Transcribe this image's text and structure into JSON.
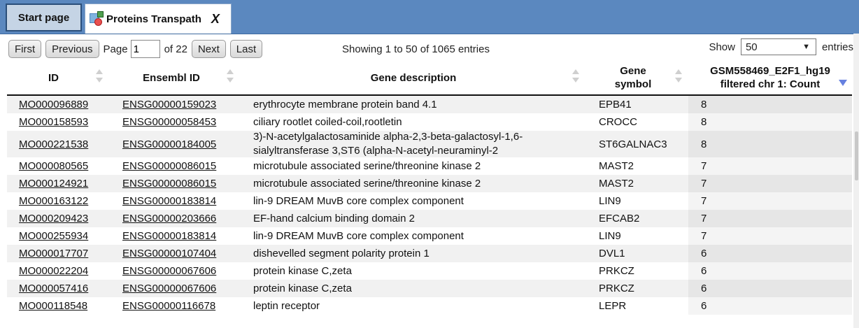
{
  "tabs": [
    {
      "label": "Start page",
      "active": false
    },
    {
      "label": "Proteins Transpath",
      "active": true,
      "close": "X"
    }
  ],
  "pager": {
    "first": "First",
    "previous": "Previous",
    "page_label": "Page",
    "page_value": "1",
    "of_label": "of 22",
    "next": "Next",
    "last": "Last"
  },
  "info": "Showing 1 to 50 of 1065 entries",
  "length": {
    "show": "Show",
    "value": "50",
    "entries": "entries"
  },
  "columns": [
    {
      "key": "id",
      "label": "ID"
    },
    {
      "key": "ensembl",
      "label": "Ensembl ID"
    },
    {
      "key": "desc",
      "label": "Gene description"
    },
    {
      "key": "symbol",
      "label": "Gene symbol"
    },
    {
      "key": "count",
      "label": "GSM558469_E2F1_hg19 filtered chr 1: Count"
    }
  ],
  "rows": [
    {
      "id": "MO000096889",
      "ensembl": "ENSG00000159023",
      "desc": "erythrocyte membrane protein band 4.1",
      "symbol": "EPB41",
      "count": "8"
    },
    {
      "id": "MO000158593",
      "ensembl": "ENSG00000058453",
      "desc": "ciliary rootlet coiled-coil,rootletin",
      "symbol": "CROCC",
      "count": "8"
    },
    {
      "id": "MO000221538",
      "ensembl": "ENSG00000184005",
      "desc": "3)-N-acetylgalactosaminide alpha-2,3-beta-galactosyl-1,6-sialyltransferase 3,ST6 (alpha-N-acetyl-neuraminyl-2",
      "symbol": "ST6GALNAC3",
      "count": "8"
    },
    {
      "id": "MO000080565",
      "ensembl": "ENSG00000086015",
      "desc": "microtubule associated serine/threonine kinase 2",
      "symbol": "MAST2",
      "count": "7"
    },
    {
      "id": "MO000124921",
      "ensembl": "ENSG00000086015",
      "desc": "microtubule associated serine/threonine kinase 2",
      "symbol": "MAST2",
      "count": "7"
    },
    {
      "id": "MO000163122",
      "ensembl": "ENSG00000183814",
      "desc": "lin-9 DREAM MuvB core complex component",
      "symbol": "LIN9",
      "count": "7"
    },
    {
      "id": "MO000209423",
      "ensembl": "ENSG00000203666",
      "desc": "EF-hand calcium binding domain 2",
      "symbol": "EFCAB2",
      "count": "7"
    },
    {
      "id": "MO000255934",
      "ensembl": "ENSG00000183814",
      "desc": "lin-9 DREAM MuvB core complex component",
      "symbol": "LIN9",
      "count": "7"
    },
    {
      "id": "MO000017707",
      "ensembl": "ENSG00000107404",
      "desc": "dishevelled segment polarity protein 1",
      "symbol": "DVL1",
      "count": "6"
    },
    {
      "id": "MO000022204",
      "ensembl": "ENSG00000067606",
      "desc": "protein kinase C,zeta",
      "symbol": "PRKCZ",
      "count": "6"
    },
    {
      "id": "MO000057416",
      "ensembl": "ENSG00000067606",
      "desc": "protein kinase C,zeta",
      "symbol": "PRKCZ",
      "count": "6"
    },
    {
      "id": "MO000118548",
      "ensembl": "ENSG00000116678",
      "desc": "leptin receptor",
      "symbol": "LEPR",
      "count": "6"
    }
  ]
}
